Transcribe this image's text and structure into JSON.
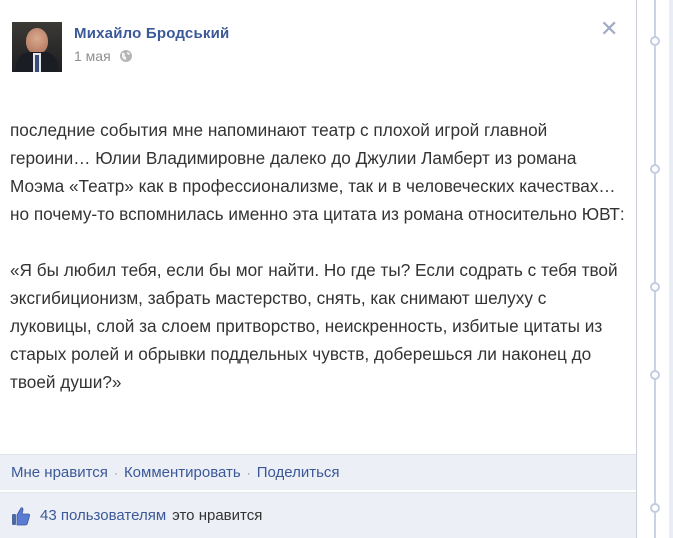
{
  "post": {
    "author": "Михайло Бродський",
    "date": "1 мая",
    "privacy_icon": "globe-icon",
    "paragraphs": [
      "последние события мне напоминают театр с плохой игрой главной героини… Юлии Владимировне далеко до Джулии Ламберт из романа Моэма «Театр» как в профессионализме, так и в человеческих качествах…но почему-то вспомнилась именно эта цитата из романа относительно ЮВТ:",
      "«Я бы любил тебя, если бы мог найти. Но где ты? Если содрать с тебя твой эксгибиционизм, забрать мастерство, снять, как снимают шелуху с луковицы, слой за слоем притворство, неискренность, избитые цитаты из старых ролей и обрывки поддельных чувств, доберешься ли наконец до твоей души?»"
    ],
    "close_glyph": "✕"
  },
  "actions": {
    "like": "Мне нравится",
    "comment": "Комментировать",
    "share": "Поделиться",
    "separator": "·"
  },
  "likes": {
    "count_text": "43 пользователям",
    "suffix": "это нравится"
  },
  "colors": {
    "link": "#3b5998",
    "text": "#333333",
    "meta": "#8f8f8f",
    "footer_bg": "#eceff5"
  }
}
